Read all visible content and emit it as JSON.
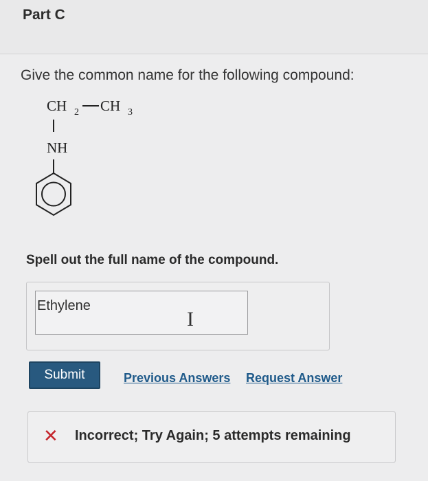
{
  "part": {
    "title": "Part C"
  },
  "question": {
    "prompt": "Give the common name for the following compound:",
    "instruction": "Spell out the full name of the compound."
  },
  "molecule": {
    "ch2": "CH",
    "ch2_sub": "2",
    "ch3": "CH",
    "ch3_sub": "3",
    "nh": "NH"
  },
  "answer": {
    "value": "Ethylene"
  },
  "actions": {
    "submit_label": "Submit",
    "previous_answers_label": "Previous Answers",
    "request_answer_label": "Request Answer"
  },
  "feedback": {
    "status_text": "Incorrect; Try Again; 5 attempts remaining",
    "status_color": "#c4242b"
  }
}
